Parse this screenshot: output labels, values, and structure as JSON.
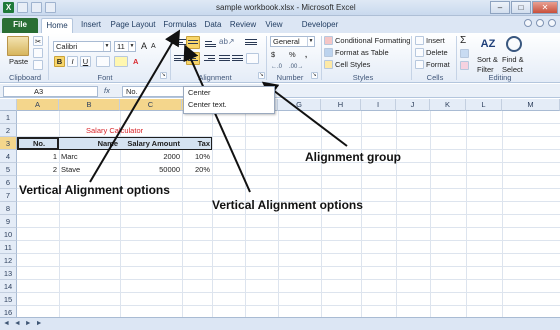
{
  "window": {
    "title": "sample workbook.xlsx - Microsoft Excel",
    "excel_logo_letter": "X"
  },
  "tabs": [
    "File",
    "Home",
    "Insert",
    "Page Layout",
    "Formulas",
    "Data",
    "Review",
    "View",
    "Developer"
  ],
  "ribbon": {
    "clipboard": {
      "paste_label": "Paste",
      "group_label": "Clipboard"
    },
    "font": {
      "font_name": "Calibri",
      "font_size": "11",
      "grow_label": "A",
      "shrink_label": "A",
      "bold": "B",
      "italic": "I",
      "underline": "U",
      "font_color_letter": "A",
      "group_label": "Font"
    },
    "alignment": {
      "group_label": "Alignment"
    },
    "number": {
      "format": "General",
      "currency": "$",
      "percent": "%",
      "comma": ",",
      "group_label": "Number"
    },
    "styles": {
      "conditional": "Conditional Formatting",
      "table": "Format as Table",
      "cell_styles": "Cell Styles",
      "group_label": "Styles"
    },
    "cells": {
      "insert": "Insert",
      "delete": "Delete",
      "format": "Format",
      "group_label": "Cells"
    },
    "editing": {
      "sigma": "Σ",
      "sort_filter_1": "Sort &",
      "sort_filter_2": "Filter",
      "find_select_1": "Find &",
      "find_select_2": "Select",
      "group_label": "Editing"
    }
  },
  "formula_bar": {
    "name_box": "A3",
    "fx": "fx",
    "value": "No."
  },
  "tooltip": {
    "title": "Center",
    "description": "Center text."
  },
  "sheet": {
    "columns": [
      "A",
      "B",
      "C",
      "D",
      "E",
      "F",
      "G",
      "H",
      "I",
      "J",
      "K",
      "L",
      "M"
    ],
    "rows": [
      "1",
      "2",
      "3",
      "4",
      "5",
      "6",
      "7",
      "8",
      "9",
      "10",
      "11",
      "12",
      "13",
      "14",
      "15",
      "16"
    ],
    "cells": {
      "b2": "Salary Calculator",
      "a3": "No.",
      "b3": "Name",
      "c3": "Salary Amount",
      "d3": "Tax",
      "a4": "1",
      "b4": "Marc",
      "c4": "2000",
      "d4": "10%",
      "a5": "2",
      "b5": "Stave",
      "c5": "50000",
      "d5": "20%"
    }
  },
  "annotations": {
    "alignment_group": "Alignment group",
    "vertical_1": "Vertical Alignment options",
    "vertical_2": "Vertical Alignment options"
  },
  "colors": {
    "file_tab": "#2a6e34",
    "title_red": "#d8262b",
    "selected_header": "#f4d68c",
    "highlight_button": "#f8d66a"
  }
}
